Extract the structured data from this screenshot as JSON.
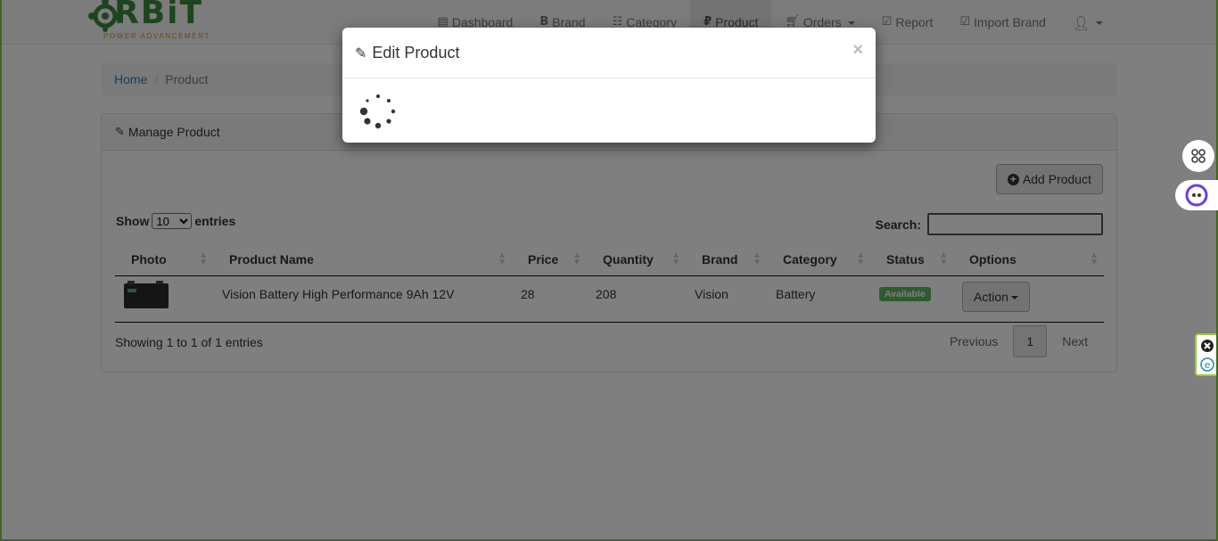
{
  "brand": {
    "logo_text": "RBiT",
    "logo_sub": "POWER ADVANCEMENT"
  },
  "nav": {
    "items": [
      {
        "label": "Dashboard",
        "icon": "list-icon"
      },
      {
        "label": "Brand",
        "icon": "bitcoin-icon"
      },
      {
        "label": "Category",
        "icon": "th-list-icon"
      },
      {
        "label": "Product",
        "icon": "ruble-icon",
        "active": true
      },
      {
        "label": "Orders",
        "icon": "cart-icon",
        "dropdown": true
      },
      {
        "label": "Report",
        "icon": "check-square-icon"
      },
      {
        "label": "Import Brand",
        "icon": "check-square-icon"
      }
    ],
    "user_icon": "user-icon"
  },
  "breadcrumb": {
    "home": "Home",
    "separator": "/",
    "current": "Product"
  },
  "panel": {
    "title": "Manage Product",
    "add_button": "Add Product",
    "show_label": "Show",
    "entries_label": "entries",
    "page_size": "10",
    "search_label": "Search:",
    "search_value": "",
    "columns": [
      "Photo",
      "Product Name",
      "Price",
      "Quantity",
      "Brand",
      "Category",
      "Status",
      "Options"
    ],
    "rows": [
      {
        "name": "Vision Battery High Performance 9Ah 12V",
        "price": "28",
        "quantity": "208",
        "brand": "Vision",
        "category": "Battery",
        "status": "Available",
        "action": "Action"
      }
    ],
    "info": "Showing 1 to 1 of 1 entries",
    "pagination": {
      "previous": "Previous",
      "page": "1",
      "next": "Next"
    }
  },
  "modal": {
    "title": "Edit Product",
    "close": "×",
    "state": "loading"
  },
  "colors": {
    "frame_border": "#8bc34a",
    "status_available": "#5cb85c",
    "link": "#337ab7",
    "logo_green": "#3a8a3a",
    "logo_orange": "#e08a1e"
  }
}
